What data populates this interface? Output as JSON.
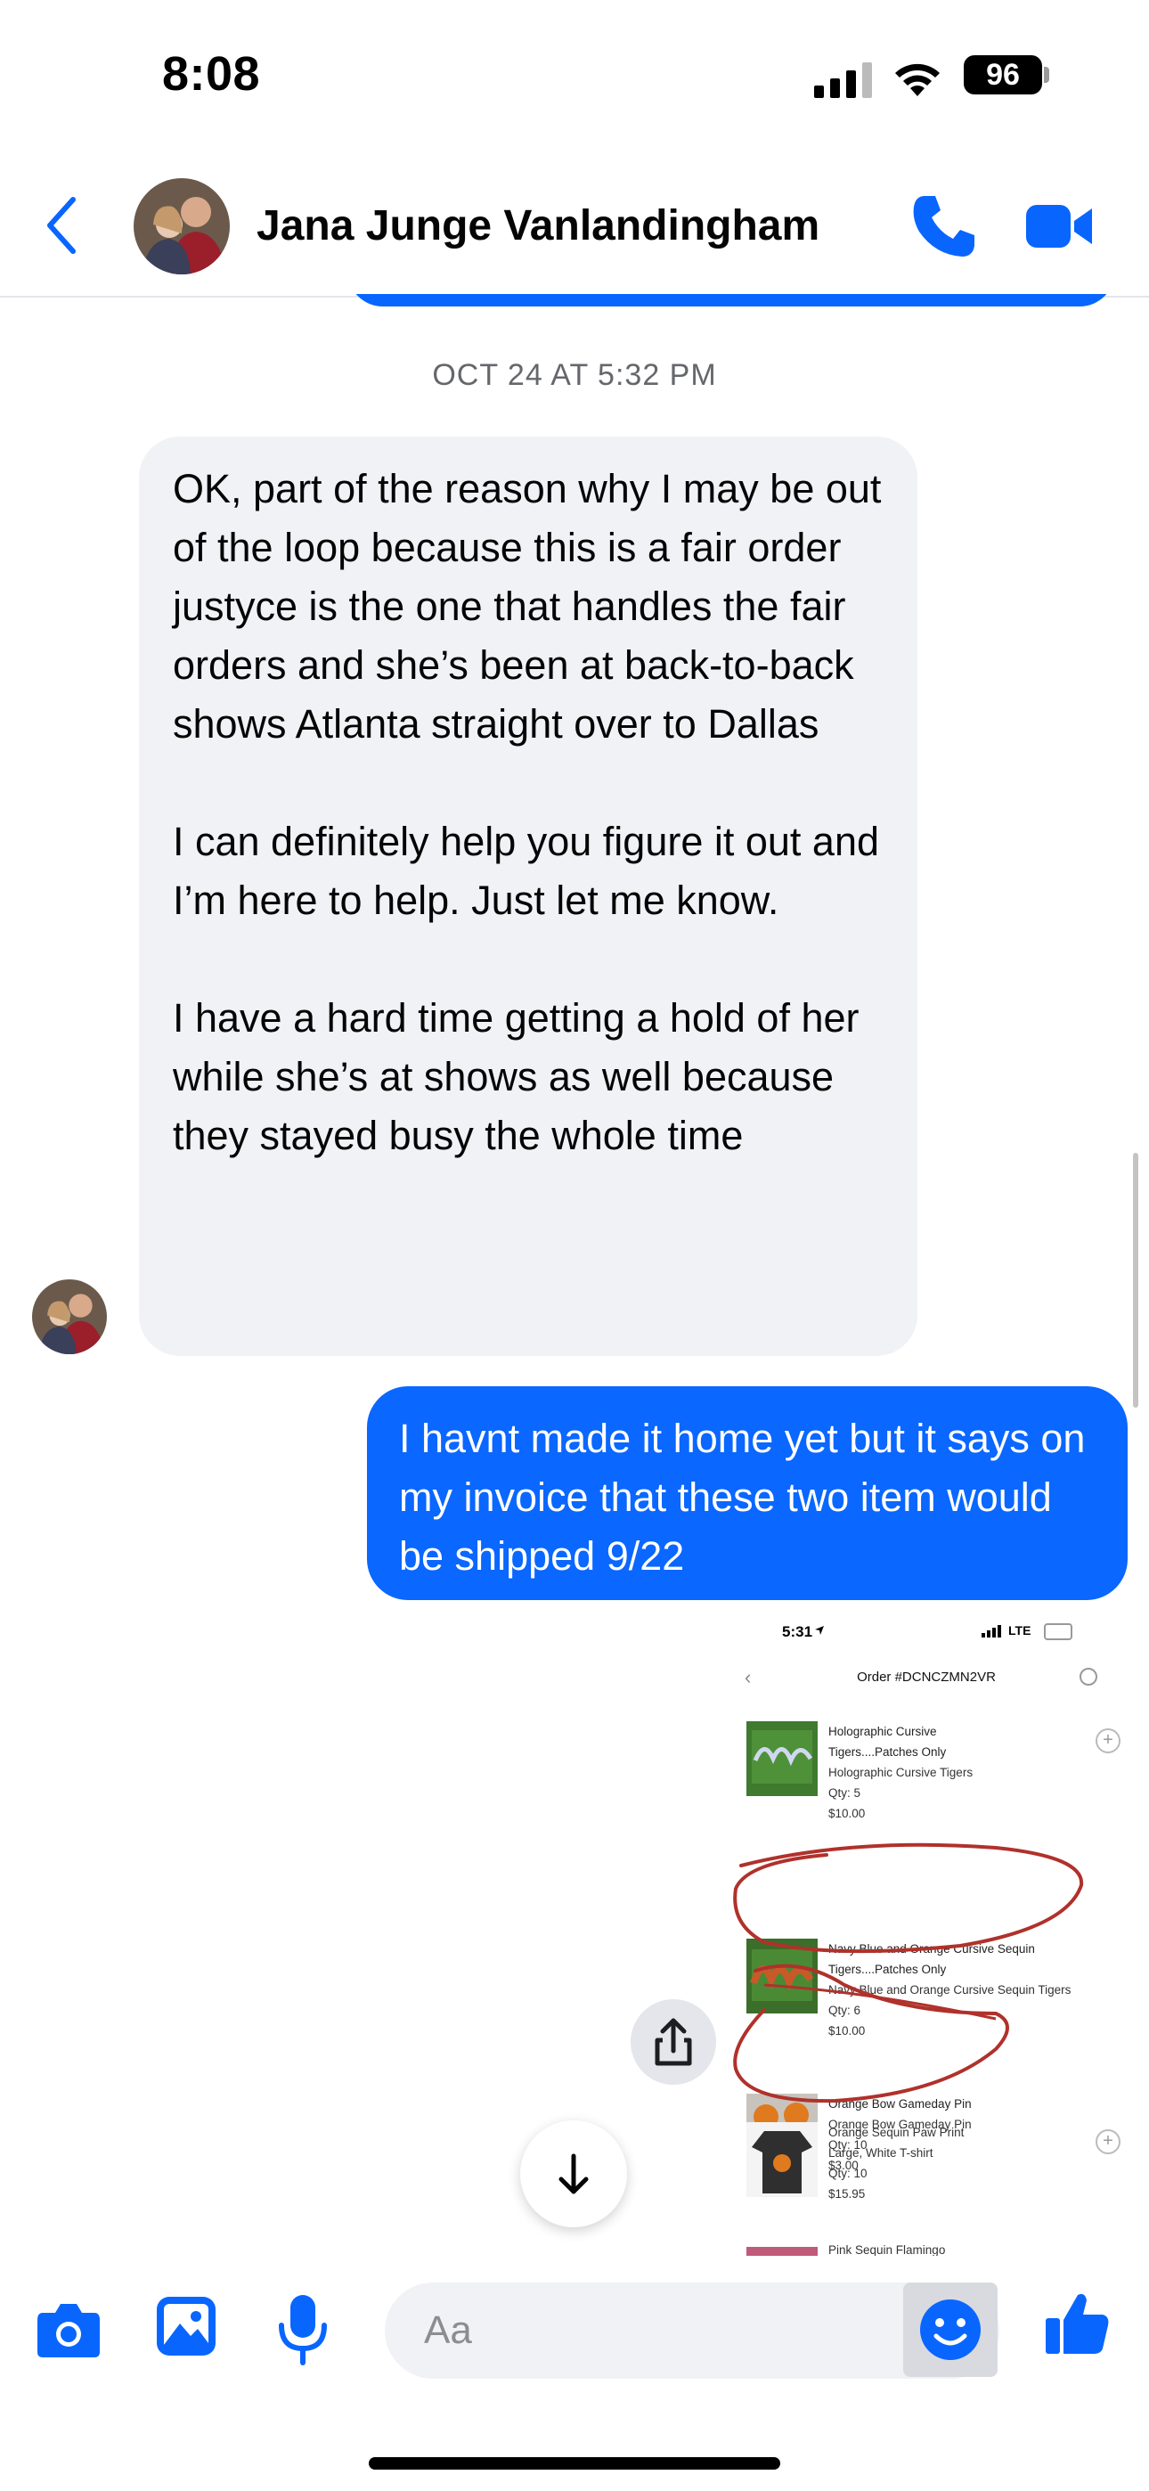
{
  "status_bar": {
    "time": "8:08",
    "battery": "96"
  },
  "header": {
    "contact_name": "Jana Junge Vanlandingham"
  },
  "thread": {
    "timestamp": "OCT 24 AT 5:32 PM",
    "incoming_paragraphs": [
      "OK, part of the reason why I may be out of the loop because this is a fair order justyce is the one that handles the fair orders and she’s been at back-to-back shows Atlanta straight over to Dallas",
      "I can definitely help you figure it out and I’m here to help. Just let me know.",
      "I have a hard time getting a hold of her while she’s at shows as well because they stayed busy the whole time"
    ],
    "outgoing_text": "I havnt made it home yet but it says on my invoice that these two item would be shipped 9/22"
  },
  "attachment": {
    "status_time": "5:31",
    "network": "LTE",
    "order_title": "Order #DCNCZMN2VR",
    "items": [
      {
        "name": "Holographic Cursive Tigers....Patches Only",
        "name_l1": "Holographic Cursive",
        "name_l2": "Tigers....Patches Only",
        "variant": "Holographic Cursive Tigers",
        "qty": "Qty: 5",
        "price": "$10.00"
      },
      {
        "name": "Navy Blue and Orange Cursive Sequin Tigers....Patches Only",
        "name_l1": "Navy Blue and Orange Cursive Sequin",
        "name_l2": "Tigers....Patches Only",
        "variant": "Navy Blue and Orange Cursive Sequin Tigers",
        "qty": "Qty: 6",
        "price": "$10.00"
      },
      {
        "name": "Orange Bow Gameday Pin",
        "variant": "Orange Bow Gameday Pin",
        "qty": "Qty: 10",
        "price": "$3.00"
      },
      {
        "name": "Orange Sequin Paw Print",
        "variant": "Large, White T-shirt",
        "qty": "Qty: 10",
        "price": "$15.95"
      },
      {
        "name": "Pink Sequin Flamingo"
      }
    ]
  },
  "composer": {
    "placeholder": "Aa"
  },
  "colors": {
    "accent": "#0866ff",
    "incoming_bg": "#f0f2f5",
    "outgoing_bg": "#0a67ff",
    "annotation": "#b0312b"
  }
}
